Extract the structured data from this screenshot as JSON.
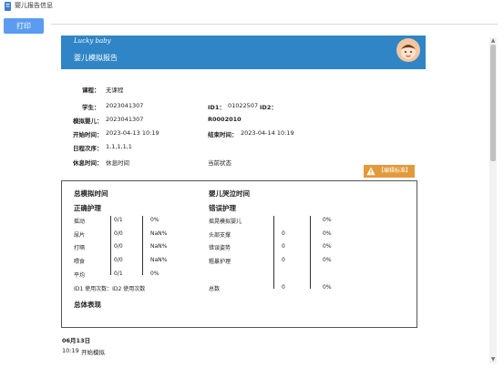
{
  "window": {
    "title": "婴儿报告信息"
  },
  "toolbar": {
    "print_label": "打印"
  },
  "header": {
    "logo_text": "Lucky baby",
    "title": "婴儿模拟报告"
  },
  "info": {
    "course_label": "课程：",
    "course_value": "无课程",
    "student_label": "学生：",
    "student_value": "2023041307",
    "id1_label": "ID1：",
    "id1_value": "01022507",
    "id2_label": "ID2：",
    "baby_label": "模拟婴儿：",
    "baby_value": "2023041307",
    "baby_code": "R0002010",
    "start_label": "开始时间：",
    "start_value": "2023-04-13 10:19",
    "end_label": "结束时间：",
    "end_value": "2023-04-14 10:19",
    "schedule_label": "日程次序：",
    "schedule_value": "1,1,1,1,1",
    "rest_label": "休息时间：",
    "rest_value": "休息时间",
    "status_label": "当前状态"
  },
  "warning_button": {
    "label": "【编辑标准】",
    "icon": "warning-icon"
  },
  "summary": {
    "total_time_title": "总模拟时间",
    "cry_time_title": "婴儿哭泣时间",
    "correct_title": "正确护理",
    "wrong_title": "错误护理",
    "correct_rows": [
      {
        "name": "摇动",
        "count": "0/1",
        "pct": "0%"
      },
      {
        "name": "尿片",
        "count": "0/0",
        "pct": "NaN%"
      },
      {
        "name": "打嗝",
        "count": "0/0",
        "pct": "NaN%"
      },
      {
        "name": "喂食",
        "count": "0/0",
        "pct": "NaN%"
      },
      {
        "name": "平均",
        "count": "0/1",
        "pct": "0%"
      }
    ],
    "wrong_rows": [
      {
        "name": "摇晃模拟婴儿",
        "count": "",
        "pct": "0%"
      },
      {
        "name": "头部支撑",
        "count": "0",
        "pct": "0%"
      },
      {
        "name": "错误姿势",
        "count": "0",
        "pct": "0%"
      },
      {
        "name": "粗暴护理",
        "count": "0",
        "pct": "0%"
      }
    ],
    "id_usage": "ID1 使用次数：ID2 使用次数",
    "total_label": "总数",
    "total_count": "0",
    "total_pct": "0%",
    "overall_title": "总体表现"
  },
  "log": {
    "date": "06月13日",
    "entry_time": "10:19",
    "entry_text": "开始模拟"
  }
}
